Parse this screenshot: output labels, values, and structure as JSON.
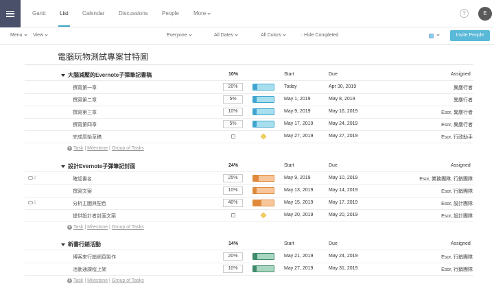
{
  "nav": {
    "tabs": [
      {
        "label": "Gantt"
      },
      {
        "label": "List"
      },
      {
        "label": "Calendar"
      },
      {
        "label": "Discussions"
      },
      {
        "label": "People"
      },
      {
        "label": "More"
      }
    ],
    "help": "?",
    "avatar": "E"
  },
  "toolbar": {
    "menu": "Menu",
    "view": "View",
    "everyone": "Everyone",
    "all_dates": "All Dates",
    "all_colors": "All Colors",
    "hide_completed": "Hide Completed",
    "invite": "Invite People"
  },
  "project": {
    "title": "電腦玩物測試專案甘特圖"
  },
  "columns": {
    "start": "Start",
    "due": "Due",
    "assigned": "Assigned"
  },
  "add_links": {
    "task": "Task",
    "sep": "|",
    "milestone": "Milestone",
    "group": "Group of Tasks"
  },
  "sections": [
    {
      "name": "大腦減壓的Evernote子彈筆記書稿",
      "pct": "10%",
      "color": "#a8dfee",
      "done_color": "#3fa5cf",
      "tasks": [
        {
          "name": "撰寫第一章",
          "pct": "20%",
          "progress": 0.2,
          "start": "Today",
          "due": "Apr 30, 2019",
          "assigned": "異塵行者",
          "comments": ""
        },
        {
          "name": "撰寫第二章",
          "pct": "5%",
          "progress": 0.05,
          "start": "May 1, 2019",
          "due": "May 8, 2019",
          "assigned": "異塵行者",
          "comments": ""
        },
        {
          "name": "撰寫第三章",
          "pct": "10%",
          "progress": 0.1,
          "start": "May 9, 2019",
          "due": "May 16, 2019",
          "assigned": "Esor, 異塵行者",
          "comments": ""
        },
        {
          "name": "撰寫第四章",
          "pct": "5%",
          "progress": 0.05,
          "start": "May 17, 2019",
          "due": "May 24, 2019",
          "assigned": "Esor, 異塵行者",
          "comments": ""
        },
        {
          "name": "完成原始草稿",
          "milestone": true,
          "start": "May 27, 2019",
          "due": "May 27, 2019",
          "assigned": "Esor, 行政助手",
          "comments": ""
        }
      ]
    },
    {
      "name": "設計Evernote子彈筆記封面",
      "pct": "24%",
      "color": "#f7c79b",
      "done_color": "#e0893a",
      "tasks": [
        {
          "name": "確認書名",
          "pct": "25%",
          "progress": 0.25,
          "start": "May 9, 2019",
          "due": "May 10, 2019",
          "assigned": "Esor, 業務團隊, 行銷團隊",
          "comments": "2"
        },
        {
          "name": "撰寫文案",
          "pct": "10%",
          "progress": 0.1,
          "start": "May 13, 2019",
          "due": "May 14, 2019",
          "assigned": "Esor, 行銷團隊",
          "comments": ""
        },
        {
          "name": "分析主圖與配色",
          "pct": "40%",
          "progress": 0.4,
          "start": "May 15, 2019",
          "due": "May 17, 2019",
          "assigned": "Esor, 設計團隊",
          "comments": "2"
        },
        {
          "name": "提供設計者封面文案",
          "milestone": true,
          "start": "May 20, 2019",
          "due": "May 20, 2019",
          "assigned": "Esor, 設計團隊",
          "comments": ""
        }
      ]
    },
    {
      "name": "新書行銷活動",
      "pct": "14%",
      "color": "#a9d6c0",
      "done_color": "#3f8a6a",
      "tasks": [
        {
          "name": "博客來行銷網頁製作",
          "pct": "20%",
          "progress": 0.2,
          "start": "May 21, 2019",
          "due": "May 24, 2019",
          "assigned": "Esor, 行銷團隊",
          "comments": ""
        },
        {
          "name": "活動通課程上架",
          "pct": "10%",
          "progress": 0.1,
          "start": "May 27, 2019",
          "due": "May 31, 2019",
          "assigned": "Esor, 行銷團隊",
          "comments": ""
        }
      ]
    }
  ]
}
